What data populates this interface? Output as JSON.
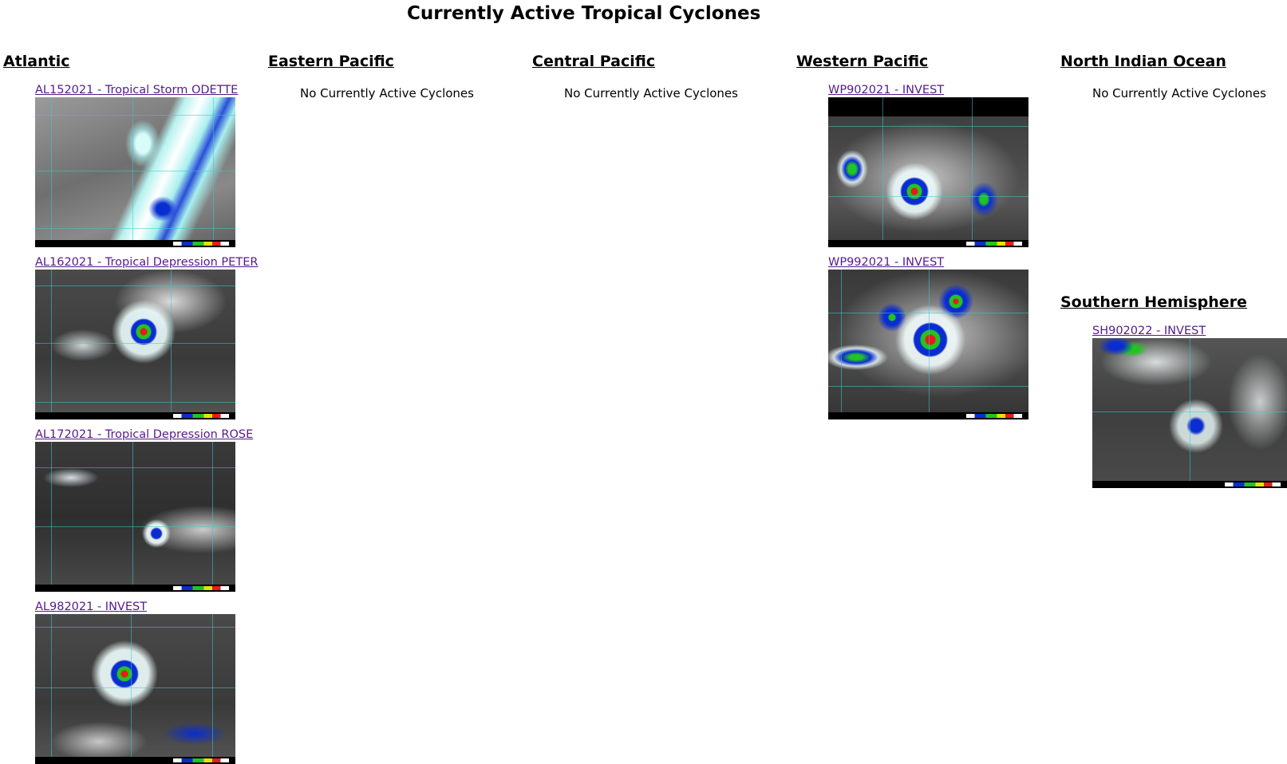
{
  "page": {
    "title": "Currently Active Tropical Cyclones"
  },
  "regions": {
    "atlantic": {
      "heading": "Atlantic",
      "storms": [
        {
          "label": "AL152021 - Tropical Storm ODETTE",
          "image_icon": "satellite-ir-image"
        },
        {
          "label": "AL162021 - Tropical Depression PETER",
          "image_icon": "satellite-ir-image"
        },
        {
          "label": "AL172021 - Tropical Depression ROSE",
          "image_icon": "satellite-ir-image"
        },
        {
          "label": "AL982021 - INVEST",
          "image_icon": "satellite-ir-image"
        }
      ]
    },
    "eastern_pacific": {
      "heading": "Eastern Pacific",
      "empty_text": "No Currently Active Cyclones"
    },
    "central_pacific": {
      "heading": "Central Pacific",
      "empty_text": "No Currently Active Cyclones"
    },
    "western_pacific": {
      "heading": "Western Pacific",
      "storms": [
        {
          "label": "WP902021 - INVEST",
          "image_icon": "satellite-ir-image"
        },
        {
          "label": "WP992021 - INVEST",
          "image_icon": "satellite-ir-image"
        }
      ]
    },
    "north_indian": {
      "heading": "North Indian Ocean",
      "empty_text": "No Currently Active Cyclones"
    },
    "southern_hemisphere": {
      "heading": "Southern Hemisphere",
      "storms": [
        {
          "label": "SH902022 - INVEST",
          "image_icon": "satellite-ir-image"
        }
      ]
    }
  },
  "colors": {
    "link_visited": "#551a8b",
    "cloud_cyan": "#a8f0ee",
    "convection_blue": "#0a2dd1",
    "convection_green": "#22c422",
    "convection_red": "#ea1a1a",
    "grid_line": "#3cc8d2"
  }
}
